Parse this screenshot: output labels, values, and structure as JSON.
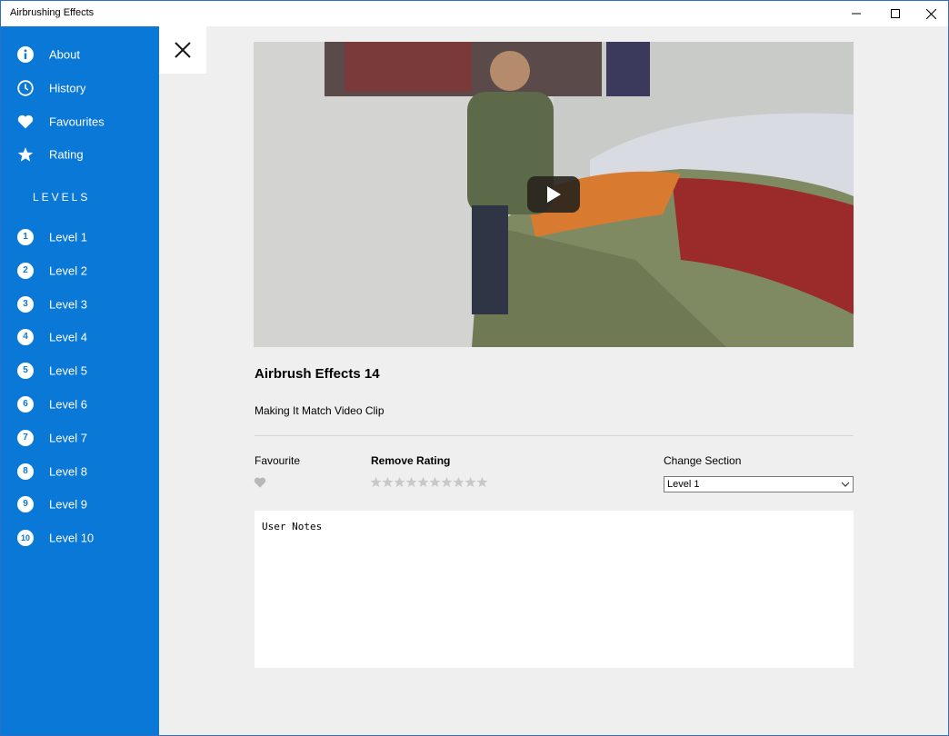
{
  "window": {
    "title": "Airbrushing Effects"
  },
  "sidebar": {
    "items": [
      {
        "label": "About",
        "icon": "info-icon"
      },
      {
        "label": "History",
        "icon": "clock-icon"
      },
      {
        "label": "Favourites",
        "icon": "heart-icon"
      },
      {
        "label": "Rating",
        "icon": "star-icon"
      }
    ],
    "levels_heading": "LEVELS",
    "levels": [
      {
        "num": "1",
        "label": "Level 1"
      },
      {
        "num": "2",
        "label": "Level 2"
      },
      {
        "num": "3",
        "label": "Level 3"
      },
      {
        "num": "4",
        "label": "Level 4"
      },
      {
        "num": "5",
        "label": "Level 5"
      },
      {
        "num": "6",
        "label": "Level 6"
      },
      {
        "num": "7",
        "label": "Level 7"
      },
      {
        "num": "8",
        "label": "Level 8"
      },
      {
        "num": "9",
        "label": "Level 9"
      },
      {
        "num": "10",
        "label": "Level 10"
      }
    ]
  },
  "video": {
    "title": "Airbrush Effects 14",
    "subtitle": "Making It Match Video Clip"
  },
  "details": {
    "favourite_label": "Favourite",
    "rating_label": "Remove Rating",
    "rating_stars": 10,
    "rating_value": 0,
    "section_label": "Change Section",
    "section_value": "Level 1"
  },
  "notes": {
    "value": "User Notes"
  },
  "colors": {
    "sidebar": "#0a78d7",
    "background": "#efefef",
    "star_empty": "#c8c8c8",
    "heart_empty": "#c0c0c0"
  }
}
